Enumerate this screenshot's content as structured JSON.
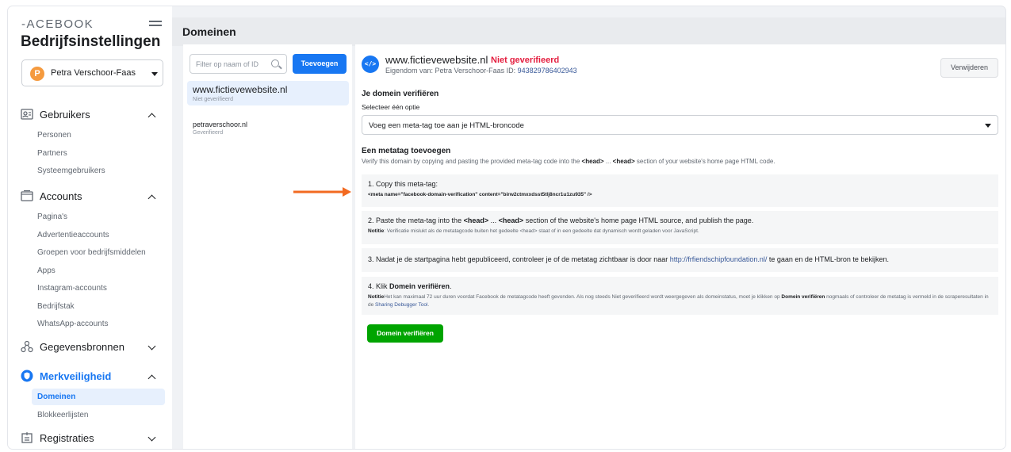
{
  "sidebar": {
    "brand": "-ACEBOOK",
    "title": "Bedrijfsinstellingen",
    "account": {
      "initial": "P",
      "name": "Petra Verschoor-Faas"
    },
    "sections": [
      {
        "label": "Gebruikers",
        "items": [
          "Personen",
          "Partners",
          "Systeemgebruikers"
        ]
      },
      {
        "label": "Accounts",
        "items": [
          "Pagina's",
          "Advertentieaccounts",
          "Groepen voor bedrijfsmiddelen",
          "Apps",
          "Instagram-accounts",
          "Bedrijfstak",
          "WhatsApp-accounts"
        ]
      },
      {
        "label": "Gegevensbronnen",
        "items": []
      },
      {
        "label": "Merkveiligheid",
        "items": [
          "Domeinen",
          "Blokkeerlijsten"
        ]
      },
      {
        "label": "Registraties",
        "items": []
      }
    ]
  },
  "header": {
    "title": "Domeinen"
  },
  "list": {
    "filter_placeholder": "Filter op naam of ID",
    "add_label": "Toevoegen",
    "domains": [
      {
        "name": "www.fictievewebsite.nl",
        "status": "Niet geverifieerd"
      },
      {
        "name": "petraverschoor.nl",
        "status": "Geverifieerd"
      }
    ]
  },
  "detail": {
    "icon": "</>",
    "site": "www.fictievewebsite.nl",
    "status": "Niet geverifieerd",
    "owner_prefix": "Eigendom van: Petra Verschoor-Faas  ID:",
    "owner_id": "943829786402943",
    "remove_label": "Verwijderen",
    "verify_title": "Je domein verifiëren",
    "select_label": "Selecteer één optie",
    "selected_option": "Voeg een meta-tag toe aan je HTML-broncode",
    "meta_title": "Een metatag toevoegen",
    "meta_desc_1": "Verify this domain by copying and pasting the provided meta-tag code into the",
    "meta_desc_head1": "<head>",
    "meta_desc_2": "...",
    "meta_desc_head2": "<head>",
    "meta_desc_3": "section of your website's home page HTML code.",
    "step1": {
      "text": "1. Copy this meta-tag:",
      "code": "<meta name=\"facebook-domain-verification\" content=\"birw2ctmxxdsst5tlj8ncr1u1zu935\" />"
    },
    "step2": {
      "text_1": "2. Paste the meta-tag into the",
      "head1": "<head>",
      "text_2": "...",
      "head2": "<head>",
      "text_3": "section of the website's home page HTML source, and publish the page.",
      "note_label": "Notitie",
      "note": ": Verificatie mislukt als de metatagcode buiten het gedeelte <head> staat of in een gedeelte dat dynamisch wordt geladen voor JavaScript."
    },
    "step3": {
      "text_1": "3. Nadat je de startpagina hebt gepubliceerd, controleer je of de metatag zichtbaar is door naar",
      "link": "http://frfiendschipfoundation.nl/",
      "text_2": "te gaan en de HTML-bron te bekijken."
    },
    "step4": {
      "text_1": "4. Klik",
      "bold": "Domein verifiëren",
      "text_2": ".",
      "note_label": "Notitie",
      "note_1": "Het kan maximaal 72 uur duren voordat Facebook de metatagcode heeft gevonden. Als nog steeds Niet geverifieerd wordt weergegeven als domeinstatus, moet je klikken op",
      "note_bold": "Domein verifiëren",
      "note_2": "nogmaals of controleer de metatag is vermeld in de scraperesultaten in de",
      "note_link": "Sharing Debugger Tool",
      "note_3": "."
    },
    "verify_button": "Domein verifiëren"
  },
  "colors": {
    "accent": "#1877f2",
    "error": "#e41e3f",
    "success": "#00a400",
    "arrow": "#f26a21"
  }
}
